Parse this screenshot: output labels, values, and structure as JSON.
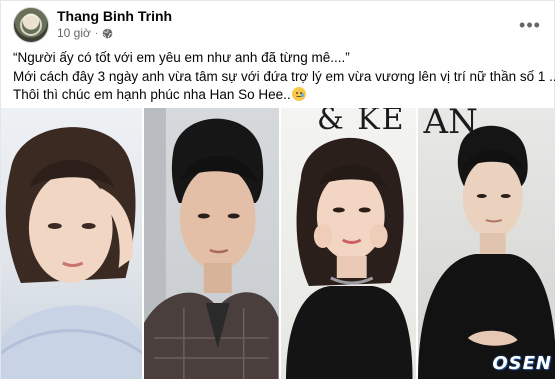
{
  "post": {
    "author": "Thang Binh Trinh",
    "time": "10 giờ",
    "separator": "·",
    "privacy_icon": "globe-icon",
    "more_icon": "more-options-icon",
    "more_label": "•••",
    "lines": [
      "“Người ấy có tốt với em yêu em như anh đã từng mê....”",
      "Mới cách đây 3 ngày anh vừa tâm sự với đứa trợ lý em vừa vương lên vị trí nữ thần số 1 ....",
      "Thôi thì chúc em hạnh phúc nha Han So Hee.."
    ],
    "emoji": "crying-face-emoji"
  },
  "photos": {
    "count": 4,
    "backdrop_text_3": "& KE",
    "backdrop_text_4": "AN",
    "watermark": "OSEN"
  },
  "colors": {
    "author": "#050505",
    "meta": "#65676b",
    "border": "#e4e6eb",
    "watermark_outline": "#1b4fa0"
  }
}
